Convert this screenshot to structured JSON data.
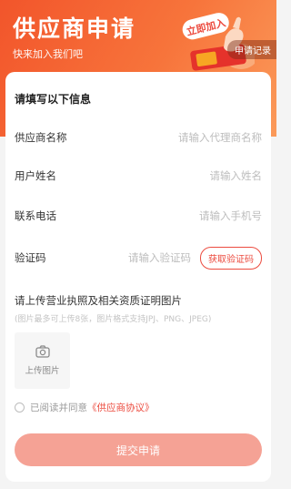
{
  "header": {
    "title": "供应商申请",
    "subtitle": "快来加入我们吧",
    "badge_text": "立即加入",
    "history_label": "申请记录",
    "colors": {
      "gradient_start": "#f2552b",
      "gradient_end": "#fb9a5a"
    }
  },
  "form": {
    "section_title": "请填写以下信息",
    "supplier_name": {
      "label": "供应商名称",
      "placeholder": "请输入代理商名称",
      "value": ""
    },
    "user_name": {
      "label": "用户姓名",
      "placeholder": "请输入姓名",
      "value": ""
    },
    "phone": {
      "label": "联系电话",
      "placeholder": "请输入手机号",
      "value": ""
    },
    "code": {
      "label": "验证码",
      "placeholder": "请输入验证码",
      "value": "",
      "button_label": "获取验证码"
    },
    "upload": {
      "title": "请上传营业执照及相关资质证明图片",
      "hint": "(图片最多可上传8张，图片格式支持JPJ、PNG、JPEG)",
      "button_label": "上传图片",
      "icon": "camera-icon"
    },
    "agreement": {
      "prefix": "已阅读并同意",
      "link": "《供应商协议》",
      "checked": false
    },
    "submit_label": "提交申请",
    "accent_color": "#ec4b3f"
  }
}
